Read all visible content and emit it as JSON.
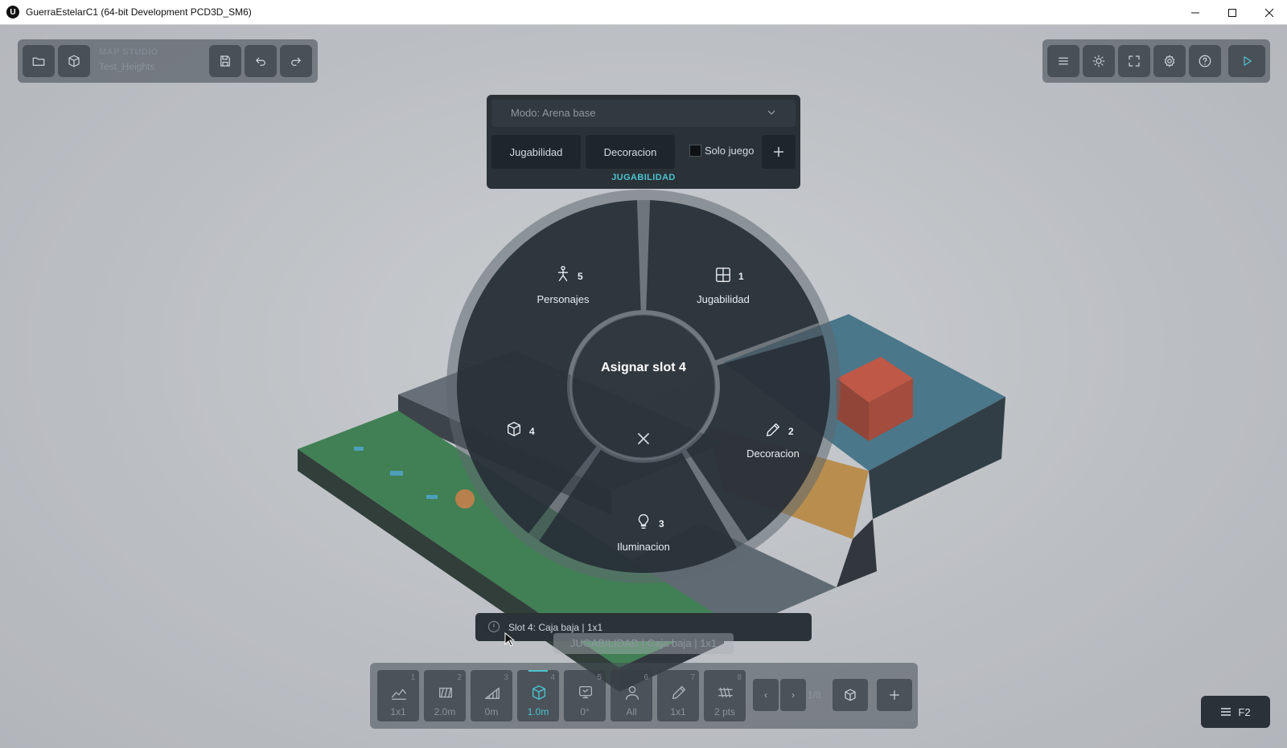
{
  "window": {
    "title": "GuerraEstelarC1 (64-bit Development PCD3D_SM6)",
    "app_icon": "unreal-engine-icon"
  },
  "top_left_toolbar": {
    "studio_label": "MAP STUDIO",
    "map_name": "Test_Heights",
    "icons": [
      "folder-open-icon",
      "cube-icon",
      "save-icon",
      "undo-icon",
      "redo-icon"
    ]
  },
  "top_right_toolbar": {
    "icons": [
      "menu-icon",
      "sun-icon",
      "fullscreen-icon",
      "settings-icon",
      "help-icon",
      "play-icon"
    ]
  },
  "mode_panel": {
    "mode_select": "Modo: Arena base",
    "tab_jugabilidad": "Jugabilidad",
    "tab_decoracion": "Decoracion",
    "solo_juego_label": "Solo juego",
    "solo_juego_checked": false,
    "caption": "JUGABILIDAD"
  },
  "radial_menu": {
    "center_title": "Asignar slot 4",
    "segments": [
      {
        "key": "personajes",
        "number": "5",
        "label": "Personajes",
        "icon": "person-icon"
      },
      {
        "key": "jugabilidad",
        "number": "1",
        "label": "Jugabilidad",
        "icon": "grid-icon"
      },
      {
        "key": "decoracion",
        "number": "2",
        "label": "Decoracion",
        "icon": "pencil-icon"
      },
      {
        "key": "iluminacion",
        "number": "3",
        "label": "Iluminacion",
        "icon": "lightbulb-icon"
      },
      {
        "key": "slot4",
        "number": "4",
        "label": "",
        "icon": "cube-icon"
      }
    ]
  },
  "tooltip": {
    "text": "Slot 4: Caja baja | 1x1",
    "subcaption": "JUGABILIDAD | Caja baja | 1x1"
  },
  "bottom_toolbar": {
    "slots": [
      {
        "number": "1",
        "value": "1x1",
        "icon": "terrain-icon",
        "active": false
      },
      {
        "number": "2",
        "value": "2.0m",
        "icon": "wall-icon",
        "active": false
      },
      {
        "number": "3",
        "value": "0m",
        "icon": "ramp-icon",
        "active": false
      },
      {
        "number": "4",
        "value": "1.0m",
        "icon": "cube-icon",
        "active": true
      },
      {
        "number": "5",
        "value": "0°",
        "icon": "rotate-icon",
        "active": false
      },
      {
        "number": "6",
        "value": "All",
        "icon": "person-icon",
        "active": false
      },
      {
        "number": "7",
        "value": "1x1",
        "icon": "pencil-icon",
        "active": false
      },
      {
        "number": "8",
        "value": "2 pts",
        "icon": "fence-icon",
        "active": false
      }
    ],
    "prev_label": "‹",
    "next_label": "›",
    "page_indicator": "1/8",
    "extra_icons": [
      "cube-icon",
      "plus-icon"
    ]
  },
  "f2_button": {
    "label": "F2",
    "icon": "sliders-icon"
  },
  "colors": {
    "accent": "#4cc3cf",
    "panel_dark": "#2a3238",
    "grass": "#2f7a45",
    "water": "#3a6f86",
    "sand": "#c08a3c",
    "red_block": "#b0402c"
  }
}
